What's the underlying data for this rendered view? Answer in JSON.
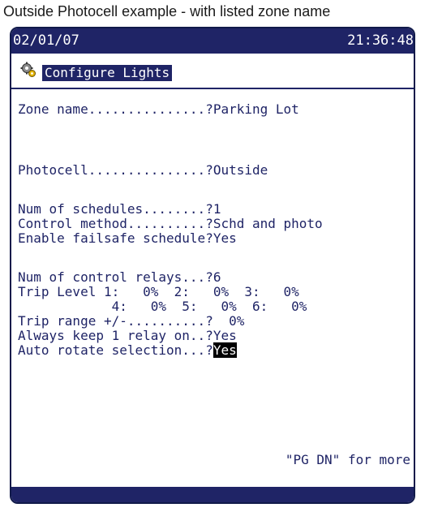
{
  "caption": "Outside Photocell example - with listed zone name",
  "status_bar": {
    "date": "02/01/07",
    "time": "21:36:48"
  },
  "screen": {
    "title": "Configure Lights",
    "icon": "gear-icon"
  },
  "fields": {
    "zone_name": "Zone name...............?Parking Lot",
    "photocell": "Photocell...............?Outside",
    "num_schedules": "Num of schedules........?1",
    "control_method": "Control method..........?Schd and photo",
    "failsafe": "Enable failsafe schedule?Yes",
    "num_relays": "Num of control relays...?6",
    "trip_level_1": "Trip Level 1:   0%  2:   0%  3:   0%",
    "trip_level_2": "            4:   0%  5:   0%  6:   0%",
    "trip_range": "Trip range +/-..........?  0%",
    "keep_relay": "Always keep 1 relay on..?Yes",
    "auto_rotate_label": "Auto rotate selection...?",
    "auto_rotate_value": "Yes"
  },
  "footer": {
    "hint": "\"PG DN\" for more"
  },
  "colors": {
    "screen_blue": "#1f2466",
    "highlight": "#000000"
  }
}
